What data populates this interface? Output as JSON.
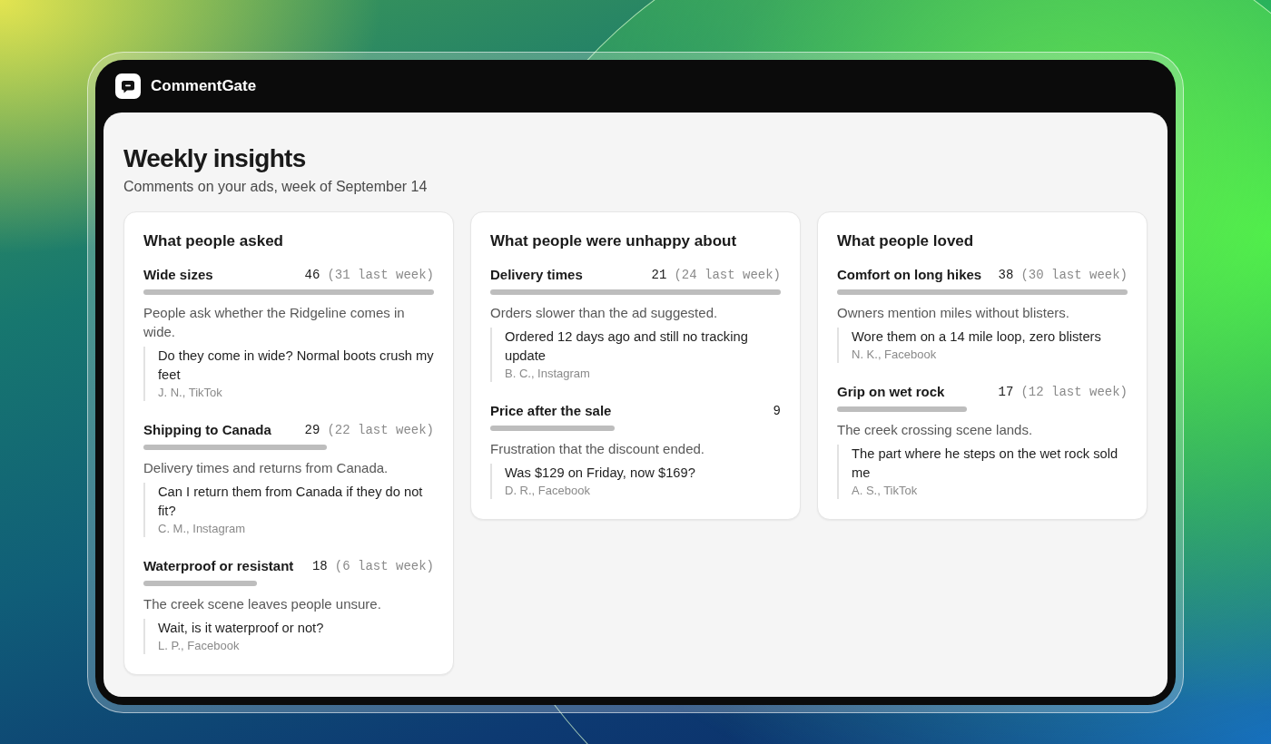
{
  "app": {
    "name": "CommentGate"
  },
  "page": {
    "title": "Weekly insights",
    "subtitle": "Comments on your ads, week of September 14"
  },
  "columns": [
    {
      "title": "What people asked",
      "topics": [
        {
          "name": "Wide sizes",
          "count": "46",
          "previous": "(31 last week)",
          "summary": "People ask whether the Ridgeline comes in wide.",
          "quotes": [
            {
              "text": "Do they come in wide? Normal boots crush my feet",
              "author": "J. N., TikTok"
            }
          ]
        },
        {
          "name": "Shipping to Canada",
          "count": "29",
          "previous": "(22 last week)",
          "summary": "Delivery times and returns from Canada.",
          "quotes": [
            {
              "text": "Can I return them from Canada if they do not fit?",
              "author": "C. M., Instagram"
            }
          ]
        },
        {
          "name": "Waterproof or resistant",
          "count": "18",
          "previous": "(6 last week)",
          "summary": "The creek scene leaves people unsure.",
          "quotes": [
            {
              "text": "Wait, is it waterproof or not?",
              "author": "L. P., Facebook"
            }
          ]
        }
      ]
    },
    {
      "title": "What people were unhappy about",
      "topics": [
        {
          "name": "Delivery times",
          "count": "21",
          "previous": "(24 last week)",
          "summary": "Orders slower than the ad suggested.",
          "quotes": [
            {
              "text": "Ordered 12 days ago and still no tracking update",
              "author": "B. C., Instagram"
            }
          ]
        },
        {
          "name": "Price after the sale",
          "count": "9",
          "summary": "Frustration that the discount ended.",
          "quotes": [
            {
              "text": "Was $129 on Friday, now $169?",
              "author": "D. R., Facebook"
            }
          ]
        }
      ]
    },
    {
      "title": "What people loved",
      "topics": [
        {
          "name": "Comfort on long hikes",
          "count": "38",
          "previous": "(30 last week)",
          "summary": "Owners mention miles without blisters.",
          "quotes": [
            {
              "text": "Wore them on a 14 mile loop, zero blisters",
              "author": "N. K., Facebook"
            }
          ]
        },
        {
          "name": "Grip on wet rock",
          "count": "17",
          "previous": "(12 last week)",
          "summary": "The creek crossing scene lands.",
          "quotes": [
            {
              "text": "The part where he steps on the wet rock sold me",
              "author": "A. S., TikTok"
            }
          ]
        }
      ]
    }
  ]
}
